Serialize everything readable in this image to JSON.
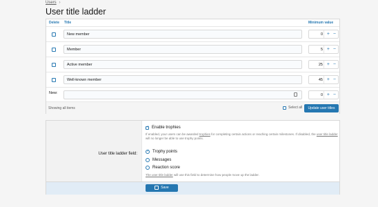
{
  "breadcrumb": {
    "item": "Users"
  },
  "page": {
    "title": "User title ladder"
  },
  "ladder": {
    "headers": {
      "delete": "Delete",
      "title": "Title",
      "minimum": "Minimum value"
    },
    "rows": [
      {
        "title": "New member",
        "minimum": "0"
      },
      {
        "title": "Member",
        "minimum": "5"
      },
      {
        "title": "Active member",
        "minimum": "25"
      },
      {
        "title": "Well-known member",
        "minimum": "45"
      }
    ],
    "new_row": {
      "label": "New:",
      "title": "",
      "minimum": "0"
    },
    "plus": "+",
    "minus": "−",
    "footer": {
      "showing": "Showing all items",
      "select_all": "Select all",
      "update_button": "Update user titles"
    }
  },
  "options": {
    "enable_trophies_label": "Enable trophies",
    "enable_trophies_hint_pre": "If enabled, your users can be awarded ",
    "enable_trophies_hint_link": "trophies",
    "enable_trophies_hint_mid": " for completing certain actions or reaching certain milestones. If disabled, the ",
    "enable_trophies_hint_link2": "user title ladder",
    "enable_trophies_hint_post": " will no longer be able to use trophy points.",
    "field_label": "User title ladder field:",
    "choices": [
      "Trophy points",
      "Messages",
      "Reaction score"
    ],
    "field_hint_link": "The user title ladder",
    "field_hint_post": " will use this field to determine how people move up the ladder.",
    "save_button": "Save"
  },
  "colors": {
    "accent": "#2577b1",
    "save_bar": "#e1ecf6"
  }
}
